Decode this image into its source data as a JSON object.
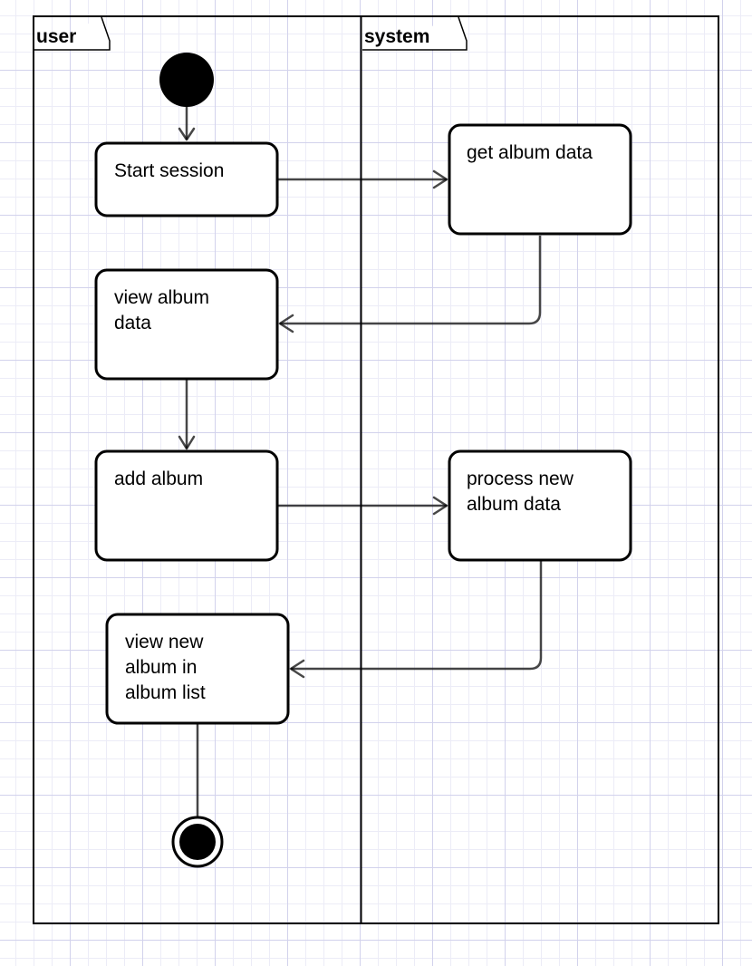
{
  "diagram": {
    "lanes": {
      "user": {
        "title": "user"
      },
      "system": {
        "title": "system"
      }
    },
    "nodes": {
      "start_session": {
        "lines": [
          "Start session"
        ]
      },
      "get_album_data": {
        "lines": [
          "get album data"
        ]
      },
      "view_album_data": {
        "lines": [
          "view album",
          "data"
        ]
      },
      "add_album": {
        "lines": [
          "add album"
        ]
      },
      "process_new_album_data": {
        "lines": [
          "process new",
          "album data"
        ]
      },
      "view_new_album": {
        "lines": [
          "view new",
          "album in",
          "album list"
        ]
      }
    }
  }
}
